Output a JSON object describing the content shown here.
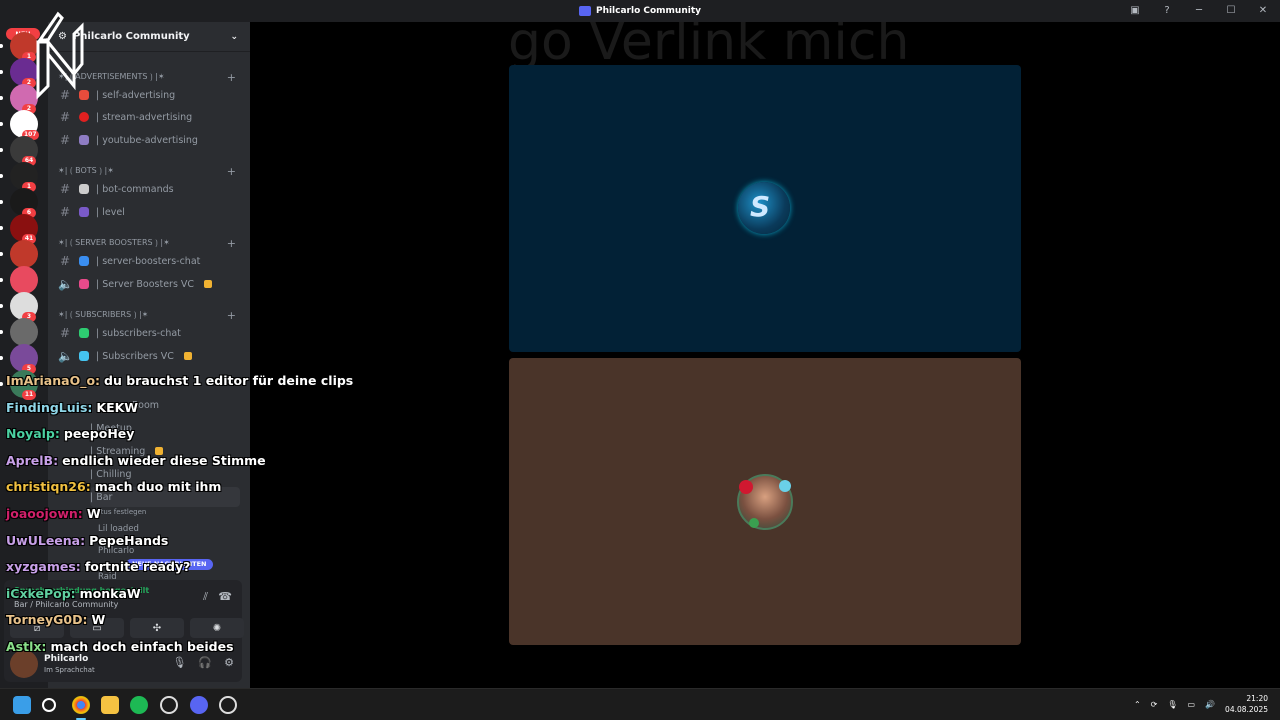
{
  "window": {
    "title": "Philcarlo Community"
  },
  "rail": {
    "new_badge": "NEU",
    "servers": [
      {
        "badge": "1",
        "color": "#c0392b"
      },
      {
        "badge": "2",
        "color": "#6a2c91"
      },
      {
        "badge": "2",
        "color": "#d06ab0"
      },
      {
        "badge": "107",
        "color": "#ffffff"
      },
      {
        "badge": "64",
        "color": "#3a3a3a"
      },
      {
        "badge": "1",
        "color": "#222222"
      },
      {
        "badge": "6",
        "color": "#1a1a1a"
      },
      {
        "badge": "41",
        "color": "#8a1010"
      },
      {
        "badge": "",
        "color": "#c0392b"
      },
      {
        "badge": "",
        "color": "#e84a5f"
      },
      {
        "badge": "3",
        "color": "#dddddd"
      },
      {
        "badge": "",
        "color": "#6a6a6a"
      },
      {
        "badge": "5",
        "color": "#7a4a9a"
      },
      {
        "badge": "11",
        "color": "#3a7a5a"
      }
    ]
  },
  "server": {
    "name": "Philcarlo Community"
  },
  "categories": [
    {
      "label": "✶| ⟮ ADVERTISEMENTS ⟯ |✶"
    },
    {
      "label": "✶| ⟮ BOTS ⟯ |✶"
    },
    {
      "label": "✶| ⟮ SERVER BOOSTERS ⟯ |✶"
    },
    {
      "label": "✶| ⟮ SUBSCRIBERS ⟯ |✶"
    }
  ],
  "channels": [
    {
      "label": "| self-advertising",
      "emoji_color": "#e74c3c"
    },
    {
      "label": "| stream-advertising",
      "emoji_color": "#e02020"
    },
    {
      "label": "| youtube-advertising",
      "emoji_color": "#8e7cc3"
    },
    {
      "label": "| bot-commands",
      "emoji_color": "#cccccc"
    },
    {
      "label": "| level",
      "emoji_color": "#7a5ac8"
    },
    {
      "label": "| server-boosters-chat",
      "emoji_color": "#3a8ef0"
    },
    {
      "label": "| Server Boosters VC",
      "emoji_color": "#e84a8a"
    },
    {
      "label": "| subscribers-chat",
      "emoji_color": "#2ecc71"
    },
    {
      "label": "| Subscribers VC",
      "emoji_color": "#45c4f0"
    }
  ],
  "hidden_channels": [
    "Room",
    "| Meetup",
    "| Streaming",
    "| Chilling",
    "| Bar"
  ],
  "voice_members": [
    "Lil loaded",
    "Philcarlo",
    "Raid"
  ],
  "voice_status_hint": "status festlegen",
  "unread_pill": "NEUE NACHRICHTEN",
  "voice_panel": {
    "connected": "Sprachverbindung hergestellt",
    "channel": "Bar / Philcarlo Community"
  },
  "user": {
    "name": "Philcarlo",
    "status": "Im Sprachchat"
  },
  "chat": [
    {
      "name": "ImArianaO_o:",
      "color": "#e8c28a",
      "msg": "du brauchst 1 editor für deine clips"
    },
    {
      "name": "FindingLuis:",
      "color": "#8fd6e8",
      "msg": "KEKW"
    },
    {
      "name": "Noyalp:",
      "color": "#4ad0a0",
      "msg": "peepoHey"
    },
    {
      "name": "AprelB:",
      "color": "#c8a0e8",
      "msg": "endlich wieder diese Stimme"
    },
    {
      "name": "christiqn26:",
      "color": "#f0c040",
      "msg": "mach duo mit ihm"
    },
    {
      "name": "joaoojown:",
      "color": "#d0206a",
      "msg": "W"
    },
    {
      "name": "UwULeena:",
      "color": "#c8a0e8",
      "msg": "PepeHands"
    },
    {
      "name": "xyzgames:",
      "color": "#c8a0e8",
      "msg": "fortnite ready?"
    },
    {
      "name": "iCxkePop:",
      "color": "#60d0a0",
      "msg": "monkaW"
    },
    {
      "name": "TorneyG0D:",
      "color": "#e8c28a",
      "msg": "W"
    },
    {
      "name": "Astlx:",
      "color": "#8ae08a",
      "msg": "mach doch einfach beides"
    }
  ],
  "stage": {
    "ghost_text": "go Verlink mich"
  },
  "taskbar": {
    "time": "21:20",
    "date": "04.08.2025"
  }
}
